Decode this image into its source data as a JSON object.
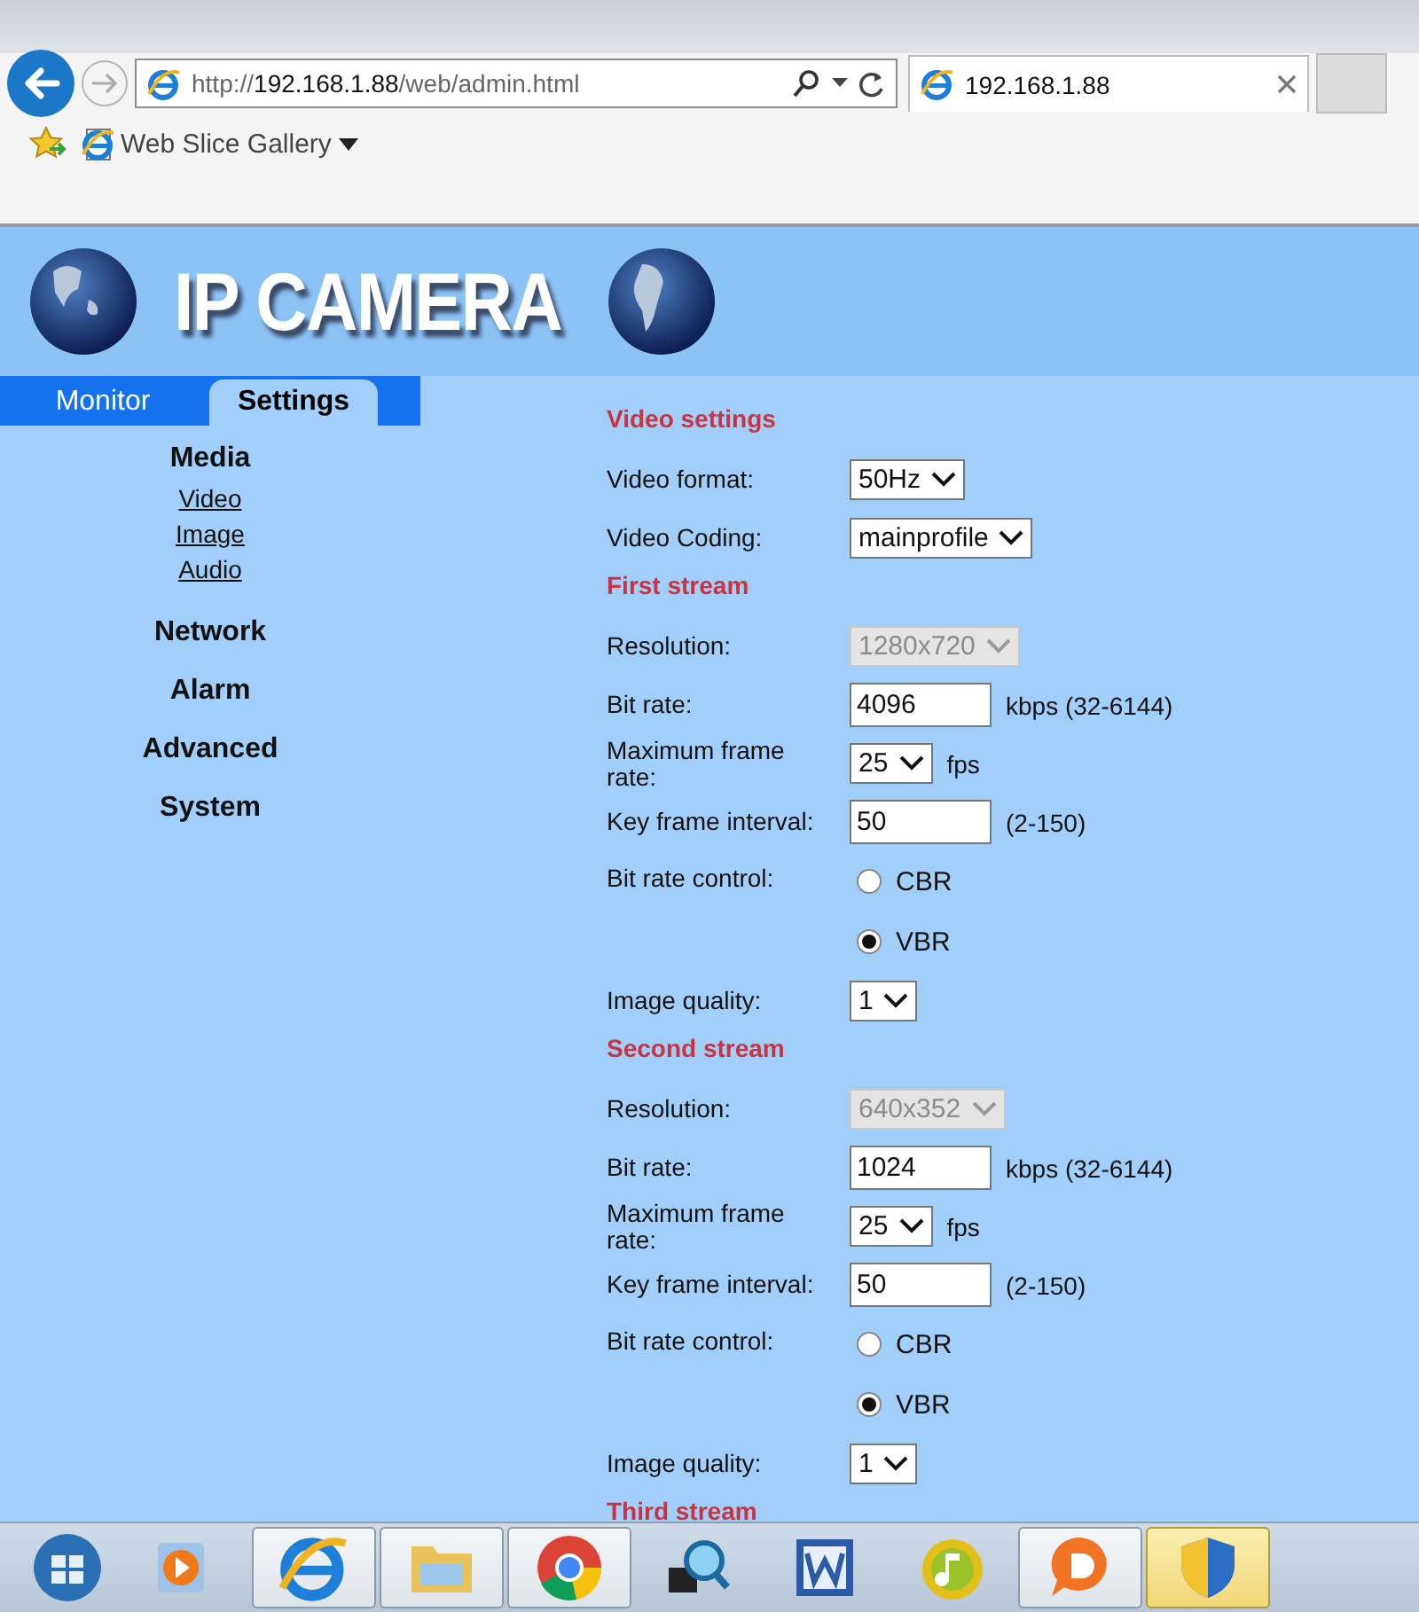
{
  "browser": {
    "address": {
      "scheme": "http://",
      "host": "192.168.1.88",
      "path": "/web/admin.html"
    },
    "tab_title": "192.168.1.88",
    "favorites": [
      {
        "label": "Web Slice Gallery"
      }
    ]
  },
  "header": {
    "logo": "IP CAMERA"
  },
  "tabs": [
    {
      "label": "Monitor",
      "selected": false
    },
    {
      "label": "Settings",
      "selected": true
    }
  ],
  "sidebar": {
    "sections": [
      {
        "label": "Media",
        "children": [
          {
            "label": "Video"
          },
          {
            "label": "Image"
          },
          {
            "label": "Audio"
          }
        ]
      },
      {
        "label": "Network"
      },
      {
        "label": "Alarm"
      },
      {
        "label": "Advanced"
      },
      {
        "label": "System"
      }
    ]
  },
  "form": [
    {
      "kind": "heading",
      "label": "Video settings"
    },
    {
      "kind": "select",
      "label": "Video format:",
      "value": "50Hz",
      "disabled": false
    },
    {
      "kind": "select",
      "label": "Video Coding:",
      "value": "mainprofile",
      "disabled": false
    },
    {
      "kind": "heading",
      "label": "First stream"
    },
    {
      "kind": "select",
      "label": "Resolution:",
      "value": "1280x720",
      "disabled": true
    },
    {
      "kind": "input",
      "label": "Bit rate:",
      "value": "4096",
      "unit": "kbps (32-6144)"
    },
    {
      "kind": "select",
      "label": "Maximum frame rate:",
      "value": "25",
      "unit": "fps",
      "disabled": false
    },
    {
      "kind": "input",
      "label": "Key frame interval:",
      "value": "50",
      "unit": "(2-150)"
    },
    {
      "kind": "radio",
      "label": "Bit rate control:",
      "options": [
        {
          "label": "CBR",
          "checked": false
        },
        {
          "label": "VBR",
          "checked": true
        }
      ]
    },
    {
      "kind": "select",
      "label": "Image quality:",
      "value": "1",
      "disabled": false
    },
    {
      "kind": "heading",
      "label": "Second stream"
    },
    {
      "kind": "select",
      "label": "Resolution:",
      "value": "640x352",
      "disabled": true
    },
    {
      "kind": "input",
      "label": "Bit rate:",
      "value": "1024",
      "unit": "kbps (32-6144)"
    },
    {
      "kind": "select",
      "label": "Maximum frame rate:",
      "value": "25",
      "unit": "fps",
      "disabled": false
    },
    {
      "kind": "input",
      "label": "Key frame interval:",
      "value": "50",
      "unit": "(2-150)"
    },
    {
      "kind": "radio",
      "label": "Bit rate control:",
      "options": [
        {
          "label": "CBR",
          "checked": false
        },
        {
          "label": "VBR",
          "checked": true
        }
      ]
    },
    {
      "kind": "select",
      "label": "Image quality:",
      "value": "1",
      "disabled": false
    },
    {
      "kind": "heading",
      "label": "Third stream"
    }
  ],
  "taskbar": [
    {
      "kind": "start",
      "selected": false
    },
    {
      "kind": "media",
      "selected": false
    },
    {
      "kind": "ie",
      "selected": false
    },
    {
      "kind": "folder",
      "selected": false
    },
    {
      "kind": "chrome",
      "selected": false
    },
    {
      "kind": "magnifier",
      "selected": false
    },
    {
      "kind": "word",
      "selected": false
    },
    {
      "kind": "music",
      "selected": false
    },
    {
      "kind": "chat",
      "selected": false
    },
    {
      "kind": "shield",
      "selected": true
    }
  ]
}
